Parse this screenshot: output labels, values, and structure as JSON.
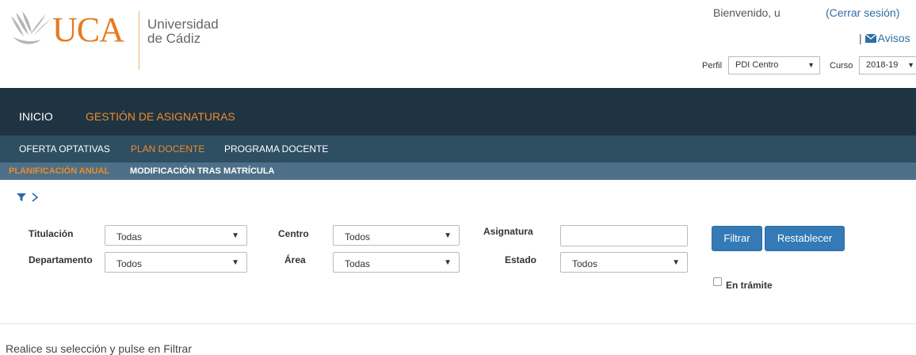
{
  "header": {
    "logo_text": "UCA",
    "university_line1": "Universidad",
    "university_line2": "de Cádiz",
    "welcome": "Bienvenido, u",
    "logout": "(Cerrar sesión)",
    "avisos_sep": "|",
    "avisos": "Avisos",
    "perfil_label": "Perfil",
    "perfil_value": "PDI Centro",
    "curso_label": "Curso",
    "curso_value": "2018-19"
  },
  "nav": {
    "primary": [
      {
        "label": "INICIO",
        "active": false
      },
      {
        "label": "GESTIÓN DE ASIGNATURAS",
        "active": true
      }
    ],
    "secondary": [
      {
        "label": "OFERTA OPTATIVAS",
        "active": false
      },
      {
        "label": "PLAN DOCENTE",
        "active": true
      },
      {
        "label": "PROGRAMA DOCENTE",
        "active": false
      }
    ],
    "tertiary": [
      {
        "label": "PLANIFICACIÓN ANUAL",
        "active": true
      },
      {
        "label": "MODIFICACIÓN TRAS MATRÍCULA",
        "active": false
      }
    ]
  },
  "filters": {
    "titulacion_label": "Titulación",
    "titulacion_value": "Todas",
    "centro_label": "Centro",
    "centro_value": "Todos",
    "asignatura_label": "Asignatura",
    "asignatura_value": "",
    "departamento_label": "Departamento",
    "departamento_value": "Todos",
    "area_label": "Área",
    "area_value": "Todas",
    "estado_label": "Estado",
    "estado_value": "Todos",
    "filtrar_button": "Filtrar",
    "restablecer_button": "Restablecer",
    "en_tramite_label": "En trámite",
    "en_tramite_checked": false
  },
  "hint": "Realice su selección y pulse en Filtrar",
  "colors": {
    "primary_nav_bg": "#1e3442",
    "secondary_nav_bg": "#2e4e61",
    "tertiary_nav_bg": "#4d7088",
    "active_accent": "#ef8a2c",
    "button_blue": "#337ab7"
  }
}
